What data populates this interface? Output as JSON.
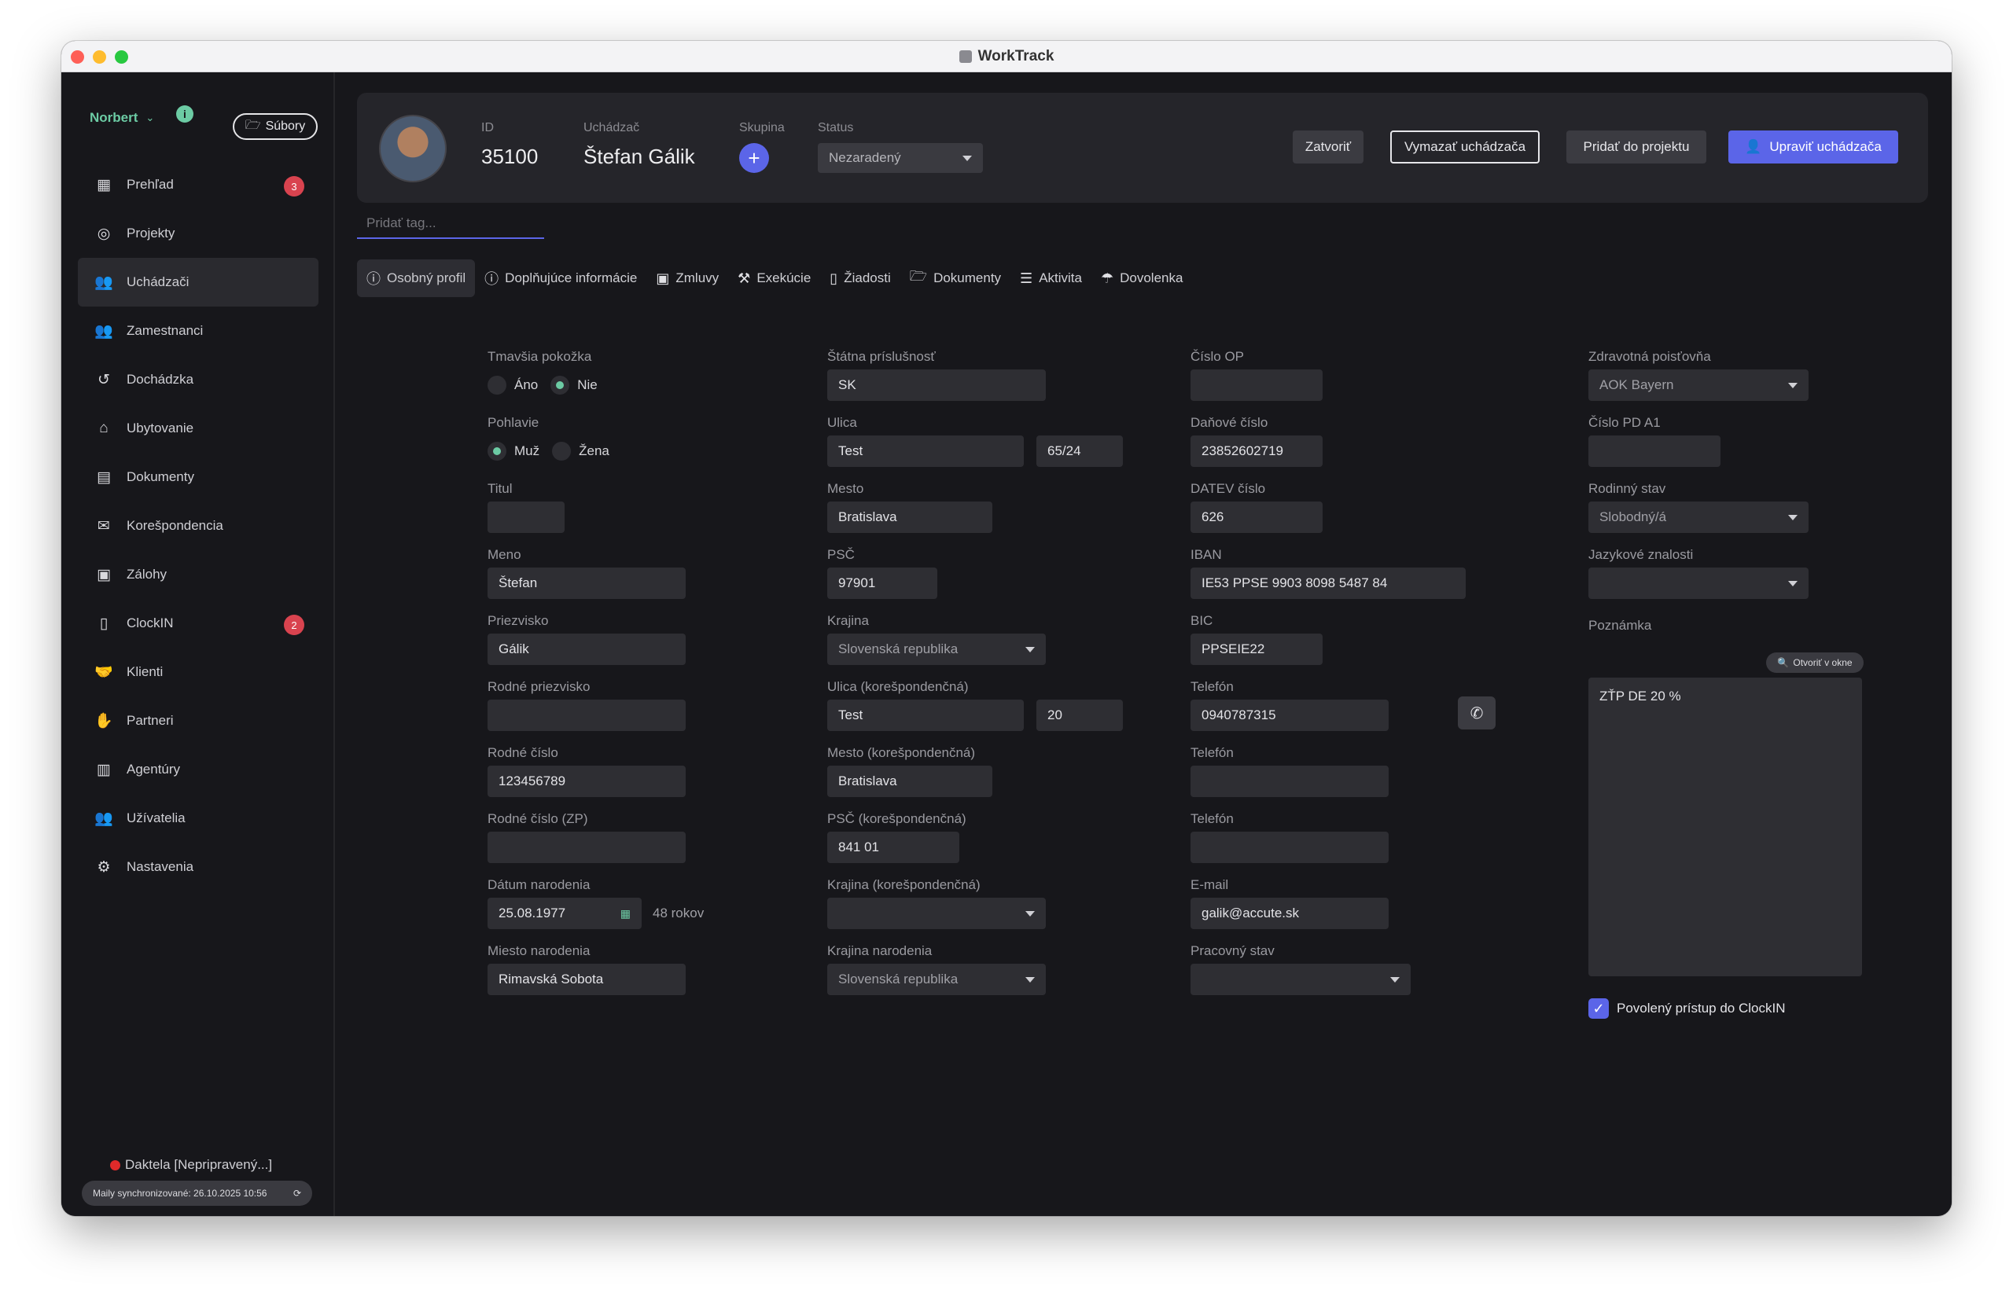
{
  "window": {
    "title": "WorkTrack"
  },
  "sidebar": {
    "user": "Norbert",
    "files_label": "Súbory",
    "items": [
      {
        "label": "Prehľad",
        "icon": "grid-icon",
        "badge": "3"
      },
      {
        "label": "Projekty",
        "icon": "projects-icon",
        "badge": ""
      },
      {
        "label": "Uchádzači",
        "icon": "candidates-icon",
        "badge": ""
      },
      {
        "label": "Zamestnanci",
        "icon": "employees-icon",
        "badge": ""
      },
      {
        "label": "Dochádzka",
        "icon": "history-icon",
        "badge": ""
      },
      {
        "label": "Ubytovanie",
        "icon": "house-icon",
        "badge": ""
      },
      {
        "label": "Dokumenty",
        "icon": "documents-icon",
        "badge": ""
      },
      {
        "label": "Korešpondencia",
        "icon": "envelope-icon",
        "badge": ""
      },
      {
        "label": "Zálohy",
        "icon": "money-icon",
        "badge": ""
      },
      {
        "label": "ClockIN",
        "icon": "mobile-icon",
        "badge": "2"
      },
      {
        "label": "Klienti",
        "icon": "handshake-icon",
        "badge": ""
      },
      {
        "label": "Partneri",
        "icon": "hands-icon",
        "badge": ""
      },
      {
        "label": "Agentúry",
        "icon": "building-icon",
        "badge": ""
      },
      {
        "label": "Užívatelia",
        "icon": "users-icon",
        "badge": ""
      },
      {
        "label": "Nastavenia",
        "icon": "gears-icon",
        "badge": ""
      }
    ],
    "daktela": "Daktela [Nepripravený...]",
    "sync": "Maily synchronizované: 26.10.2025 10:56"
  },
  "header": {
    "id_label": "ID",
    "id_value": "35100",
    "candidate_label": "Uchádzač",
    "candidate_value": "Štefan Gálik",
    "group_label": "Skupina",
    "status_label": "Status",
    "status_value": "Nezaradený",
    "btn_close": "Zatvoriť",
    "btn_delete": "Vymazať uchádzača",
    "btn_add_project": "Pridať do projektu",
    "btn_edit": "Upraviť uchádzača"
  },
  "tag_placeholder": "Pridať tag...",
  "tabs": [
    {
      "label": "Osobný profil",
      "icon": "info-icon"
    },
    {
      "label": "Doplňujúce informácie",
      "icon": "info-icon"
    },
    {
      "label": "Zmluvy",
      "icon": "money-icon"
    },
    {
      "label": "Exekúcie",
      "icon": "gavel-icon"
    },
    {
      "label": "Žiadosti",
      "icon": "mobile-icon"
    },
    {
      "label": "Dokumenty",
      "icon": "folder-icon"
    },
    {
      "label": "Aktivita",
      "icon": "list-icon"
    },
    {
      "label": "Dovolenka",
      "icon": "umbrella-icon"
    }
  ],
  "form": {
    "col1": {
      "dark_skin": {
        "label": "Tmavšia pokožka",
        "opt_yes": "Áno",
        "opt_no": "Nie"
      },
      "gender": {
        "label": "Pohlavie",
        "opt_male": "Muž",
        "opt_female": "Žena"
      },
      "title": {
        "label": "Titul",
        "value": ""
      },
      "first_name": {
        "label": "Meno",
        "value": "Štefan"
      },
      "last_name": {
        "label": "Priezvisko",
        "value": "Gálik"
      },
      "birth_surname": {
        "label": "Rodné priezvisko",
        "value": ""
      },
      "birth_number": {
        "label": "Rodné číslo",
        "value": "123456789"
      },
      "birth_number_zp": {
        "label": "Rodné číslo (ZP)",
        "value": ""
      },
      "birth_date": {
        "label": "Dátum narodenia",
        "value": "25.08.1977",
        "age": "48 rokov"
      },
      "birth_place": {
        "label": "Miesto narodenia",
        "value": "Rimavská Sobota"
      }
    },
    "col2": {
      "citizenship": {
        "label": "Štátna príslušnosť",
        "value": "SK"
      },
      "street": {
        "label": "Ulica",
        "value": "Test",
        "number": "65/24"
      },
      "city": {
        "label": "Mesto",
        "value": "Bratislava"
      },
      "zip": {
        "label": "PSČ",
        "value": "97901"
      },
      "country": {
        "label": "Krajina",
        "value": "Slovenská republika"
      },
      "corr_street": {
        "label": "Ulica (korešpondenčná)",
        "value": "Test",
        "number": "20"
      },
      "corr_city": {
        "label": "Mesto (korešpondenčná)",
        "value": "Bratislava"
      },
      "corr_zip": {
        "label": "PSČ (korešpondenčná)",
        "value": "841 01"
      },
      "corr_country": {
        "label": "Krajina (korešpondenčná)",
        "value": ""
      },
      "birth_country": {
        "label": "Krajina narodenia",
        "value": "Slovenská republika"
      }
    },
    "col3": {
      "id_card": {
        "label": "Číslo OP",
        "value": ""
      },
      "tax_number": {
        "label": "Daňové číslo",
        "value": "23852602719"
      },
      "datev": {
        "label": "DATEV číslo",
        "value": "626"
      },
      "iban": {
        "label": "IBAN",
        "value": "IE53 PPSE 9903 8098 5487 84"
      },
      "bic": {
        "label": "BIC",
        "value": "PPSEIE22"
      },
      "phone1": {
        "label": "Telefón",
        "value": "0940787315"
      },
      "phone2": {
        "label": "Telefón",
        "value": ""
      },
      "phone3": {
        "label": "Telefón",
        "value": ""
      },
      "email": {
        "label": "E-mail",
        "value": "galik@accute.sk"
      },
      "work_status": {
        "label": "Pracovný stav",
        "value": ""
      }
    },
    "col4": {
      "insurance": {
        "label": "Zdravotná poisťovňa",
        "value": "AOK Bayern"
      },
      "pd_a1": {
        "label": "Číslo PD A1",
        "value": ""
      },
      "marital": {
        "label": "Rodinný stav",
        "value": "Slobodný/á"
      },
      "languages": {
        "label": "Jazykové znalosti",
        "value": ""
      },
      "note": {
        "label": "Poznámka",
        "open_label": "Otvoriť v okne",
        "value": "ZŤP DE 20 %"
      },
      "clockin": {
        "label": "Povolený prístup do ClockIN",
        "checked": true
      }
    }
  },
  "colors": {
    "accent": "#5b65e8",
    "green": "#6ccba4",
    "badge": "#d9434f",
    "bg": "#17171b"
  }
}
